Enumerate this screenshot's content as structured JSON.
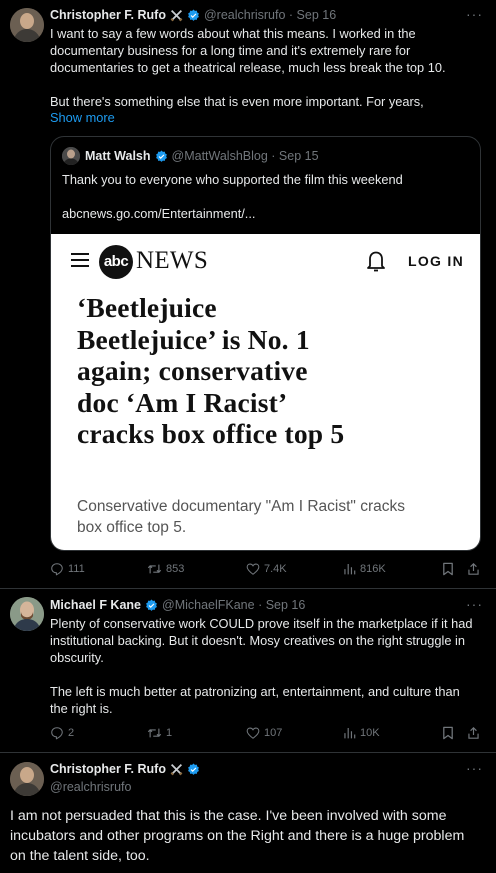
{
  "tweet1": {
    "author_name": "Christopher F. Rufo",
    "handle_time": "@realchrisrufo · Sep 16",
    "text_lines": [
      "I want to say a few words about what this means. I worked in the",
      "documentary business for a long time and it's extremely rare for",
      "documentaries to get a theatrical release, much less break the top 10.",
      "",
      "But there's something else that is even more important. For years,"
    ],
    "show_more": "Show more",
    "more": "···",
    "quote": {
      "author_name": "Matt Walsh",
      "handle_time": "@MattWalshBlog · Sep 15",
      "text": "Thank you to everyone who supported the film this weekend",
      "link": "abcnews.go.com/Entertainment/...",
      "card": {
        "logo_abc": "abc",
        "logo_news": "NEWS",
        "login": "LOG IN",
        "headline_lines": [
          "‘Beetlejuice",
          "Beetlejuice’ is No. 1",
          "again; conservative",
          "doc ‘Am I Racist’",
          "cracks box office top 5"
        ],
        "sub_lines": [
          "Conservative documentary \"Am I Racist\" cracks",
          "box office top 5."
        ]
      }
    },
    "actions": {
      "replies": "111",
      "reposts": "853",
      "likes": "7.4K",
      "views": "816K"
    }
  },
  "tweet2": {
    "author_name": "Michael F Kane",
    "handle_time": "@MichaelFKane · Sep 16",
    "text_lines": [
      "Plenty of conservative work COULD prove itself in the marketplace if it had",
      "institutional backing. But it doesn't. Mosy creatives on the right struggle in",
      "obscurity.",
      "",
      "The left is much better at patronizing art, entertainment, and culture than",
      "the right is."
    ],
    "more": "···",
    "actions": {
      "replies": "2",
      "reposts": "1",
      "likes": "107",
      "views": "10K"
    }
  },
  "tweet3": {
    "author_name": "Christopher F. Rufo",
    "handle": "@realchrisrufo",
    "more": "···",
    "text_lines": [
      "I am not persuaded that this is the case. I've been involved with some",
      "incubators and other programs on the Right and there is a huge problem",
      "on the talent side, too."
    ]
  },
  "colors": {
    "background": "#000000",
    "text": "#e7e9ea",
    "muted": "#71767b",
    "accent": "#1d9bf0",
    "border": "#2f3336"
  }
}
